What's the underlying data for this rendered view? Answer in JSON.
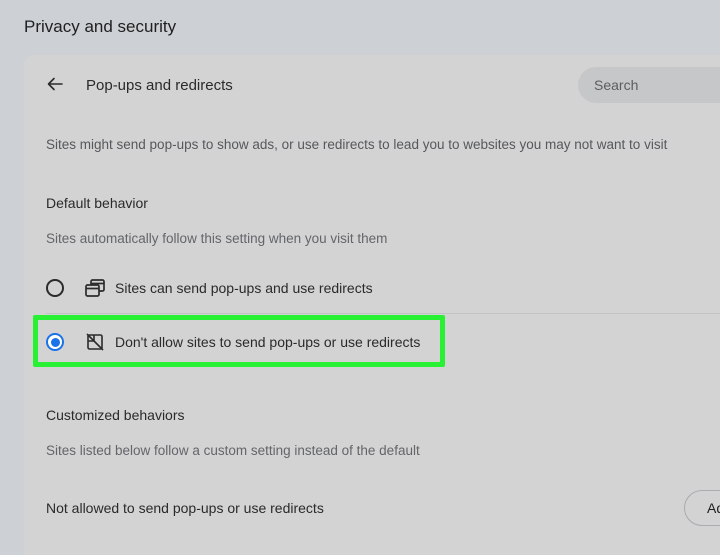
{
  "header": {
    "title": "Privacy and security"
  },
  "subpage": {
    "title": "Pop-ups and redirects",
    "back_icon": "arrow-left-icon",
    "search": {
      "placeholder": "Search"
    },
    "description": "Sites might send pop-ups to show ads, or use redirects to lead you to websites you may not want to visit"
  },
  "default_behavior": {
    "title": "Default behavior",
    "subtitle": "Sites automatically follow this setting when you visit them",
    "options": [
      {
        "label": "Sites can send pop-ups and use redirects",
        "icon": "popup-windows-icon",
        "selected": false
      },
      {
        "label": "Don't allow sites to send pop-ups or use redirects",
        "icon": "popup-blocked-icon",
        "selected": true
      }
    ]
  },
  "customized_behaviors": {
    "title": "Customized behaviors",
    "subtitle": "Sites listed below follow a custom setting instead of the default",
    "not_allowed_label": "Not allowed to send pop-ups or use redirects",
    "add_button_label": "Add"
  },
  "colors": {
    "accent": "#1a73e8",
    "highlight": "#28f032",
    "background": "#cdd0d4",
    "card": "#d3d3d3"
  }
}
